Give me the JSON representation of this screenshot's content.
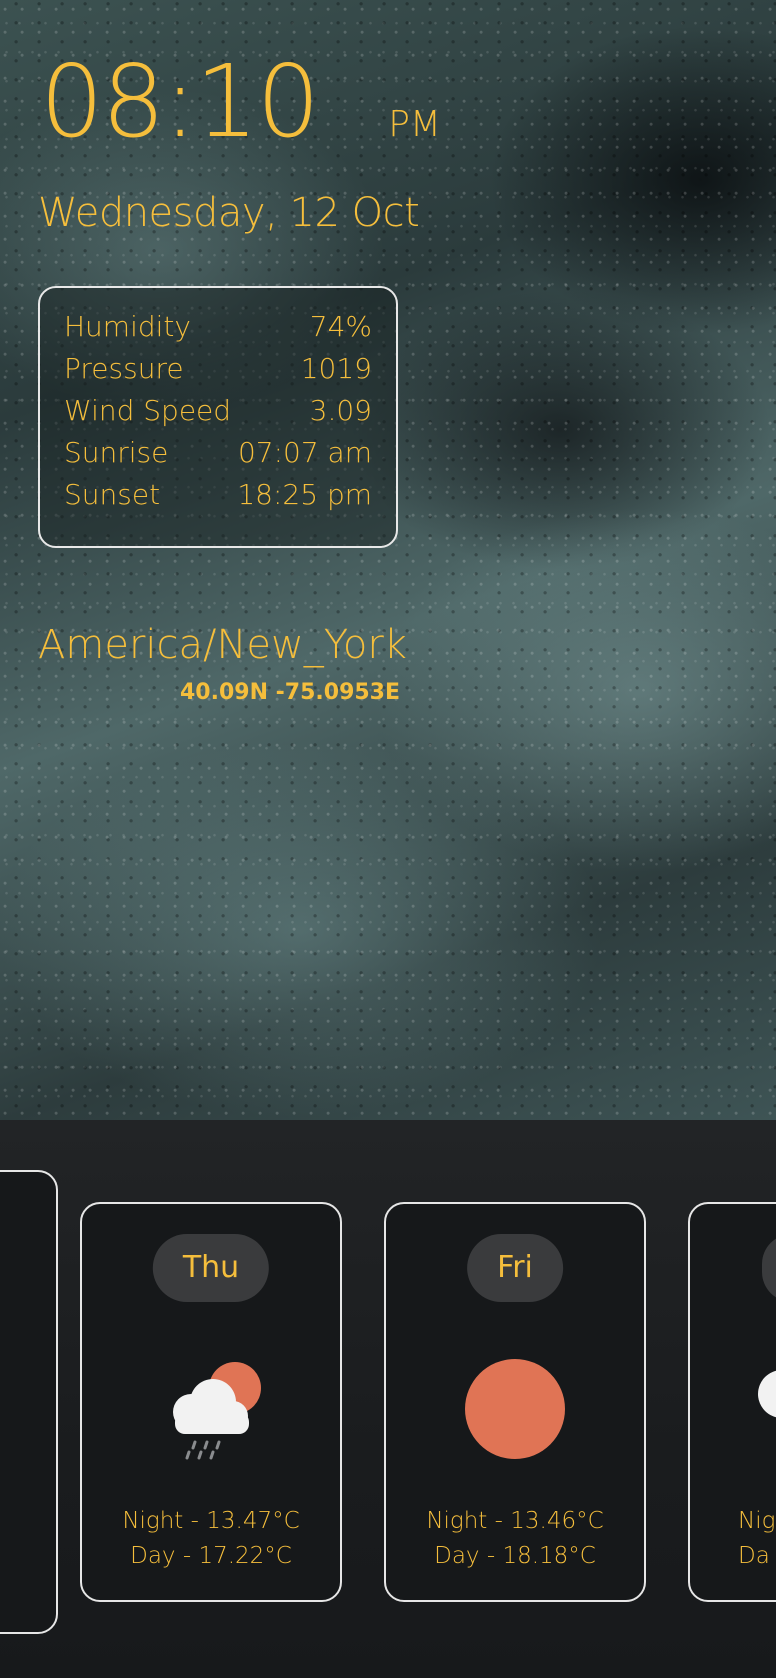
{
  "clock": {
    "time": "08:10",
    "ampm": "PM"
  },
  "date": "Wednesday, 12 Oct",
  "stats": [
    {
      "label": "Humidity",
      "value": "74%"
    },
    {
      "label": "Pressure",
      "value": "1019"
    },
    {
      "label": "Wind Speed",
      "value": "3.09"
    },
    {
      "label": "Sunrise",
      "value": "07:07 am"
    },
    {
      "label": "Sunset",
      "value": "18:25 pm"
    }
  ],
  "location": {
    "timezone": "America/New_York",
    "coords": "40.09N -75.0953E"
  },
  "forecast": [
    {
      "day": "Thu",
      "icon": "cloud-rain-sun-icon",
      "night": "Night - 13.47°C",
      "dayTemp": "Day - 17.22°C"
    },
    {
      "day": "Fri",
      "icon": "sun-icon",
      "night": "Night - 13.46°C",
      "dayTemp": "Day - 18.18°C"
    },
    {
      "day": "",
      "icon": "cloud-icon",
      "night": "Nig",
      "dayTemp": "Da"
    }
  ],
  "colors": {
    "accent": "#f5be3c",
    "sun": "#e07455",
    "card_border": "#e6e6e6"
  }
}
